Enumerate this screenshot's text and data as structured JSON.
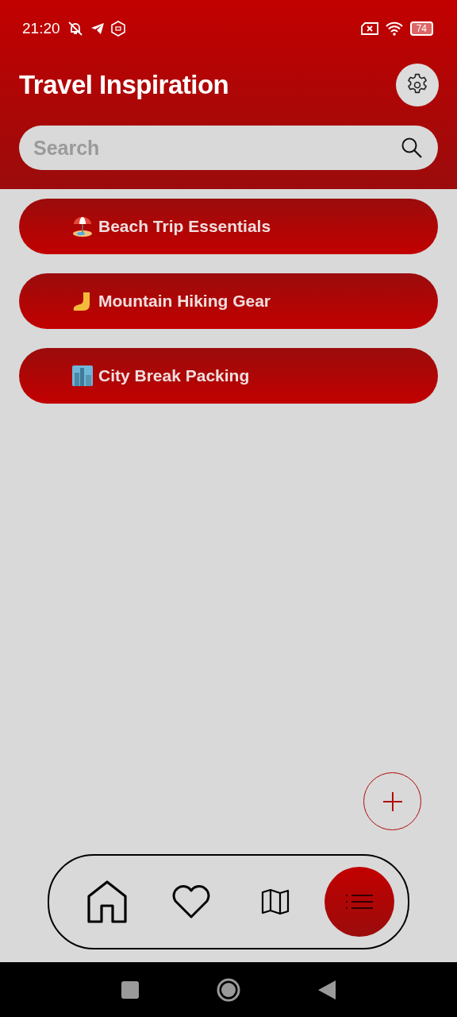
{
  "status_bar": {
    "time": "21:20",
    "battery": "74"
  },
  "header": {
    "title": "Travel Inspiration"
  },
  "search": {
    "placeholder": "Search"
  },
  "lists": [
    {
      "kind": "beach",
      "title": "Beach Trip Essentials"
    },
    {
      "kind": "hiking",
      "title": "Mountain Hiking Gear"
    },
    {
      "kind": "city",
      "title": "City Break Packing"
    }
  ],
  "bottom_nav": [
    {
      "kind": "home",
      "selected": false
    },
    {
      "kind": "favorites",
      "selected": false
    },
    {
      "kind": "map",
      "selected": false
    },
    {
      "kind": "lists",
      "selected": true
    }
  ]
}
